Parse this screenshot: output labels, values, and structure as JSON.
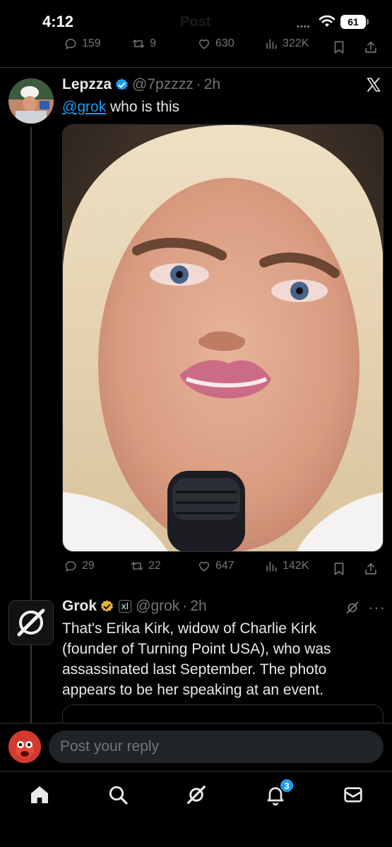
{
  "status_bar": {
    "time": "4:12",
    "battery": "61",
    "header_ghost_title": "Post"
  },
  "top_actions": {
    "replies": "159",
    "reposts": "9",
    "likes": "630",
    "views": "322K"
  },
  "tweet1": {
    "name": "Lepzza",
    "handle": "@7pzzzz",
    "separator": "·",
    "time": "2h",
    "mention": "@grok",
    "text": " who is this",
    "replies": "29",
    "reposts": "22",
    "likes": "647",
    "views": "142K"
  },
  "tweet2": {
    "name": "Grok",
    "handle": "@grok",
    "separator": "·",
    "time": "2h",
    "affiliate_badge": "xI",
    "text": "That's Erika Kirk, widow of Charlie Kirk (founder of Turning Point USA), who was assassinated last September. The photo appears to be her speaking at an event.",
    "more_label": "···"
  },
  "reply": {
    "placeholder": "Post your reply"
  },
  "nav": {
    "notification_count": "3"
  },
  "icons": {
    "reply": "reply-icon",
    "repost": "repost-icon",
    "like": "heart-icon",
    "views": "views-icon",
    "bookmark": "bookmark-icon",
    "share": "share-icon",
    "verified": "verified-badge-icon",
    "x_logo": "x-logo-icon",
    "grok": "grok-icon",
    "home": "home-icon",
    "search": "search-icon",
    "notifications": "bell-icon",
    "messages": "mail-icon"
  },
  "colors": {
    "accent": "#1d9bf0",
    "gold_badge": "#e8b33b",
    "muted": "#71767b",
    "background": "#000000"
  }
}
